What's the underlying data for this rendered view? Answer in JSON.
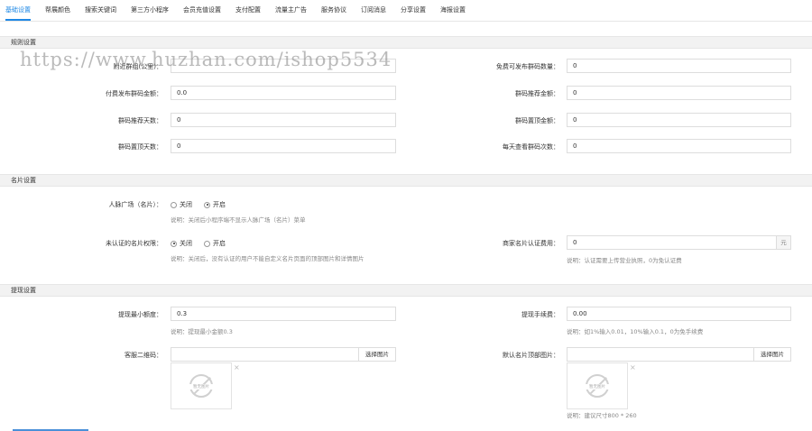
{
  "tabs": [
    "基础设置",
    "帮展颜色",
    "搜索关键词",
    "第三方小程序",
    "会员充值设置",
    "支付配置",
    "流量主广告",
    "服务协议",
    "订阅消息",
    "分享设置",
    "海报设置"
  ],
  "watermark": "https://www.huzhan.com/ishop5534",
  "rules": {
    "title": "规则设置",
    "left": [
      {
        "label": "附近群组(公里)：",
        "value": ""
      },
      {
        "label": "付费发布群码金额：",
        "value": "0.0"
      },
      {
        "label": "群码推荐天数：",
        "value": "0"
      },
      {
        "label": "群码置顶天数：",
        "value": "0"
      }
    ],
    "right": [
      {
        "label": "免费可发布群码数量：",
        "value": "0"
      },
      {
        "label": "群码推荐金额：",
        "value": "0"
      },
      {
        "label": "群码置顶金额：",
        "value": "0"
      },
      {
        "label": "每天查看群码次数：",
        "value": "0"
      }
    ]
  },
  "card": {
    "title": "名片设置",
    "plaza": {
      "label": "人脉广场（名片）：",
      "off": "关闭",
      "on": "开启",
      "selected": "on",
      "hint": "说明：关闭后小程序端不显示人脉广场（名片）菜单"
    },
    "unverified": {
      "label": "未认证的名片权限：",
      "off": "关闭",
      "on": "开启",
      "selected": "off",
      "hint": "说明：关闭后，没有认证的用户不能自定义名片页面的顶部图片和详情图片"
    },
    "fee": {
      "label": "商家名片认证费用：",
      "value": "0",
      "unit": "元",
      "hint": "说明：认证需要上传营业执照，0为免认证费"
    }
  },
  "withdraw": {
    "title": "提现设置",
    "min": {
      "label": "提现最小额度：",
      "value": "0.3",
      "hint": "说明：提现最小金额0.3"
    },
    "fee": {
      "label": "提现手续费：",
      "value": "0.00",
      "hint": "说明：如1%输入0.01，10%输入0.1，0为免手续费"
    },
    "qrcode": {
      "label": "客服二维码：",
      "value": "",
      "button": "选择图片",
      "noimg": "暂无图片"
    },
    "banner": {
      "label": "默认名片顶部图片：",
      "value": "",
      "button": "选择图片",
      "noimg": "暂无图片",
      "hint": "说明：建议尺寸800 * 260"
    }
  }
}
